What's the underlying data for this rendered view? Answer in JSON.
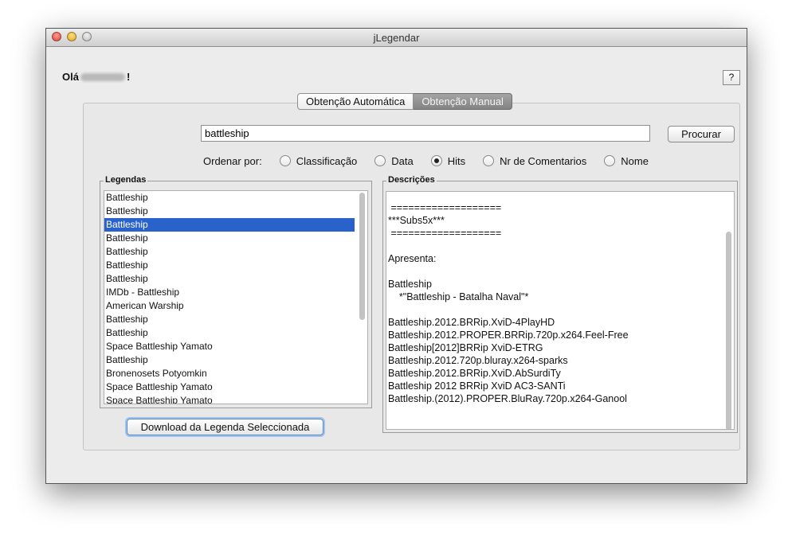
{
  "window": {
    "title": "jLegendar"
  },
  "greeting": {
    "prefix": "Olá",
    "suffix": "!"
  },
  "help": {
    "label": "?"
  },
  "tabs": [
    {
      "label": "Obtenção Automática",
      "active": false
    },
    {
      "label": "Obtenção Manual",
      "active": true
    }
  ],
  "search": {
    "value": "battleship",
    "button_label": "Procurar"
  },
  "sort": {
    "label": "Ordenar por:",
    "options": [
      "Classificação",
      "Data",
      "Hits",
      "Nr de Comentarios",
      "Nome"
    ],
    "selected": "Hits"
  },
  "legendas": {
    "title": "Legendas",
    "selected_index": 2,
    "items": [
      "Battleship",
      "Battleship",
      "Battleship",
      "Battleship",
      "Battleship",
      "Battleship",
      "Battleship",
      "IMDb - Battleship",
      "American Warship",
      "Battleship",
      "Battleship",
      "Space Battleship Yamato",
      "Battleship",
      "Bronenosets Potyomkin",
      "Space Battleship Yamato",
      "Space Battleship Yamato"
    ]
  },
  "descricoes": {
    "title": "Descrições",
    "lines": [
      " ===================",
      "***Subs5x***",
      " ===================",
      "",
      "Apresenta:",
      "",
      "Battleship",
      "    *\"Battleship - Batalha Naval\"*",
      "",
      "Battleship.2012.BRRip.XviD-4PlayHD",
      "Battleship.2012.PROPER.BRRip.720p.x264.Feel-Free",
      "Battleship[2012]BRRip XviD-ETRG",
      "Battleship.2012.720p.bluray.x264-sparks",
      "Battleship.2012.BRRip.XviD.AbSurdiTy",
      "Battleship 2012 BRRip XviD AC3-SANTi",
      "Battleship.(2012).PROPER.BluRay.720p.x264-Ganool"
    ]
  },
  "download": {
    "label": "Download da Legenda Seleccionada"
  }
}
